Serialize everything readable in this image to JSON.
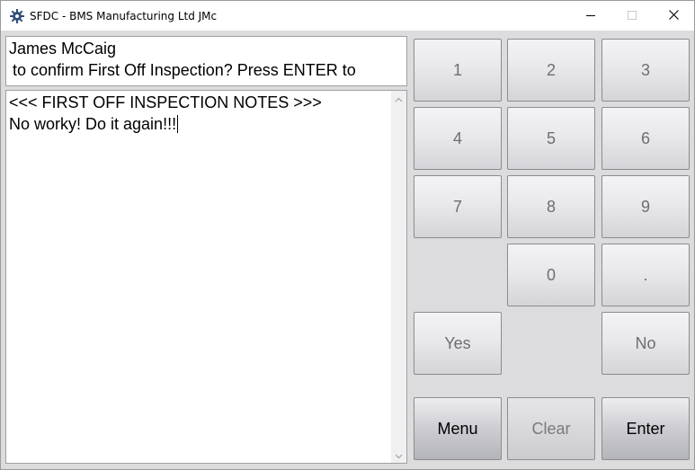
{
  "window": {
    "title": "SFDC - BMS Manufacturing Ltd JMc",
    "app_icon": "gear-icon",
    "controls": {
      "minimize": "minimize-icon",
      "maximize": "maximize-icon",
      "close": "close-icon"
    }
  },
  "operator": {
    "name": "James McCaig",
    "prompt": "to confirm First Off Inspection? Press ENTER to"
  },
  "notes": {
    "line1": "<<< FIRST OFF INSPECTION NOTES >>>",
    "line2": "No worky! Do it again!!!"
  },
  "keypad": {
    "k1": "1",
    "k2": "2",
    "k3": "3",
    "k4": "4",
    "k5": "5",
    "k6": "6",
    "k7": "7",
    "k8": "8",
    "k9": "9",
    "k0": "0",
    "dot": ".",
    "yes": "Yes",
    "no": "No",
    "menu": "Menu",
    "clear": "Clear",
    "enter": "Enter"
  },
  "colors": {
    "client_background": "#dcdcdf",
    "key_text_enabled": "#000000",
    "key_text_disabled": "#6e6e6e"
  }
}
